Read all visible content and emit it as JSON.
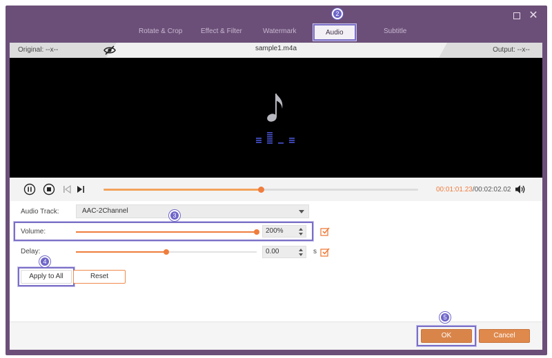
{
  "window": {
    "maximize_icon": "maximize-icon",
    "close_icon": "close-icon",
    "close_glyph": "✕"
  },
  "tabs": [
    {
      "label": "Rotate & Crop",
      "active": false
    },
    {
      "label": "Effect & Filter",
      "active": false
    },
    {
      "label": "Watermark",
      "active": false
    },
    {
      "label": "Audio",
      "active": true
    },
    {
      "label": "Subtitle",
      "active": false
    }
  ],
  "infobar": {
    "original": "Original: --x--",
    "filename": "sample1.m4a",
    "output": "Output: --x--",
    "eye_icon": "eye-hidden-icon"
  },
  "player": {
    "current_time": "00:01:01.23",
    "separator": "/",
    "total_time": "00:02:02.02",
    "progress": 0.5,
    "icons": [
      "pause-icon",
      "stop-icon",
      "skip-back-icon",
      "skip-forward-icon",
      "volume-icon"
    ]
  },
  "settings": {
    "audio_track_label": "Audio Track:",
    "audio_track_value": "AAC-2Channel",
    "volume_label": "Volume:",
    "volume_value": "200%",
    "volume_fraction": 1.0,
    "delay_label": "Delay:",
    "delay_value": "0.00",
    "delay_unit": "s",
    "delay_fraction": 0.5
  },
  "buttons": {
    "apply_to_all": "Apply to All",
    "reset": "Reset",
    "ok": "OK",
    "cancel": "Cancel"
  },
  "steps": [
    "2",
    "3",
    "4",
    "5"
  ],
  "colors": {
    "accent": "#ef7d3c",
    "frame": "#6b4f78",
    "highlight": "#7a6fc6"
  }
}
